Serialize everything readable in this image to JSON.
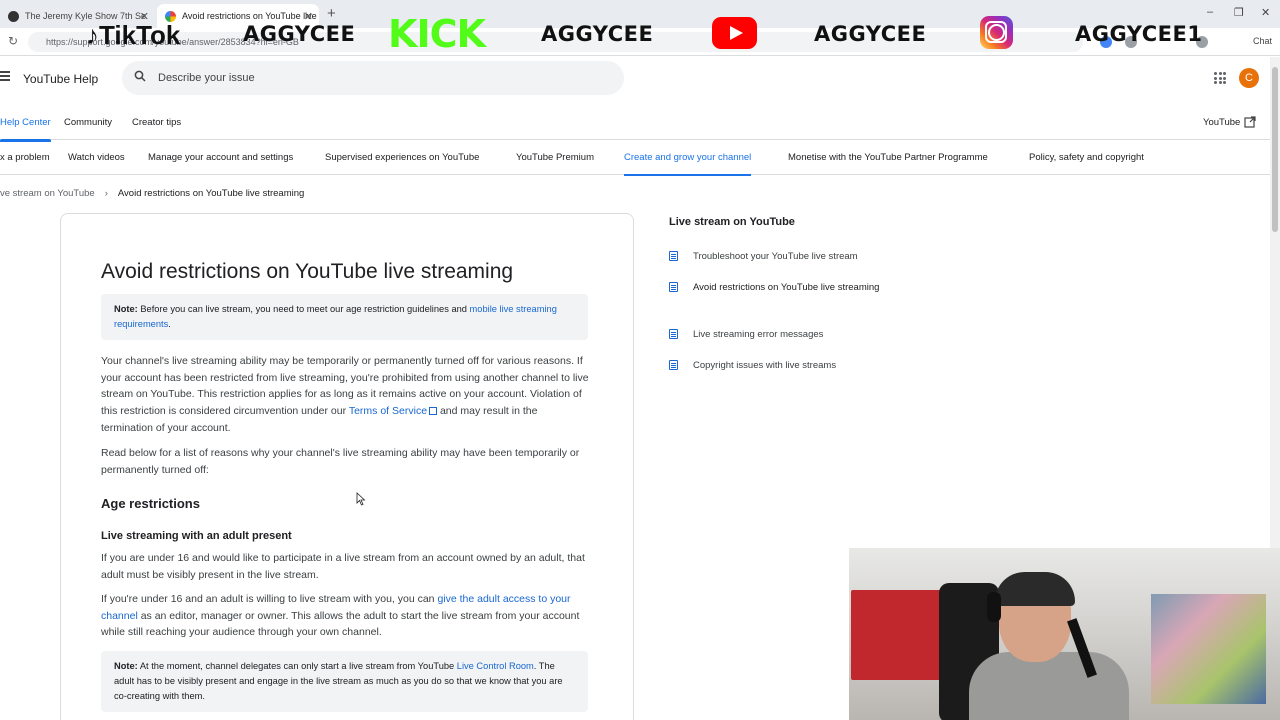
{
  "browser": {
    "tabs": [
      {
        "title": "The Jeremy Kyle Show 7th Se",
        "close": "✕"
      },
      {
        "title": "Avoid restrictions on YouTube live",
        "close": "✕"
      }
    ],
    "new_tab": "+",
    "url": "https://support.google.com/youtube/answer/2853834?hl=en-GB",
    "chat_label": "Chat",
    "window_controls": [
      "–",
      "❐",
      "✕"
    ]
  },
  "overlay": {
    "tiktok_label": "TikTok",
    "tiktok_name": "AGGYCEE",
    "kick_label": "KICK",
    "kick_name": "AGGYCEE",
    "youtube_name": "AGGYCEE",
    "instagram_name": "AGGYCEE1",
    "colors": {
      "kick": "#53fc18",
      "youtube": "#ff0000"
    }
  },
  "header": {
    "brand": "YouTube Help",
    "search_placeholder": "Describe your issue",
    "avatar_initial": "C",
    "avatar_color": "#e8710a"
  },
  "subnav": {
    "items": [
      "Help Center",
      "Community",
      "Creator tips"
    ],
    "active_index": 0,
    "youtube_link": "YouTube"
  },
  "topics": {
    "items": [
      "x a problem",
      "Watch videos",
      "Manage your account and settings",
      "Supervised experiences on YouTube",
      "YouTube Premium",
      "Create and grow your channel",
      "Monetise with the YouTube Partner Programme",
      "Policy, safety and copyright"
    ],
    "active_index": 5,
    "accent": "#1a73e8"
  },
  "breadcrumb": {
    "parent": "ve stream on YouTube",
    "separator": "›",
    "current": "Avoid restrictions on YouTube live streaming"
  },
  "article": {
    "title": "Avoid restrictions on YouTube live streaming",
    "note1": {
      "label": "Note:",
      "text": " Before you can live stream, you need to meet our age restriction guidelines and ",
      "link": "mobile live streaming requirements",
      "end": "."
    },
    "para1": {
      "text": "Your channel's live streaming ability may be temporarily or permanently turned off for various reasons. If your account has been restricted from live streaming, you're prohibited from using another channel to live stream on YouTube. This restriction applies for as long as it remains active on your account. Violation of this restriction is considered circumvention under our ",
      "link": "Terms of Service",
      "end": " and may result in the termination of your account."
    },
    "para2": "Read below for a list of reasons why your channel's live streaming ability may have been temporarily or permanently turned off:",
    "section_heading": "Age restrictions",
    "subheading": "Live streaming with an adult present",
    "para3": "If you are under 16 and would like to participate in a live stream from an account owned by an adult, that adult must be visibly present in the live stream.",
    "para4": {
      "text": "If you're under 16 and an adult is willing to live stream with you, you can ",
      "link": "give the adult access to your channel",
      "end": " as an editor, manager or owner. This allows the adult to start the live stream from your account while still reaching your audience through your own channel."
    },
    "note2": {
      "label": "Note:",
      "text": " At the moment, channel delegates can only start a live stream from YouTube ",
      "link": "Live Control Room",
      "end": ". The adult has to be visibly present and engage in the live stream as much as you do so that we know that you are co-creating with them."
    }
  },
  "sidebar": {
    "title": "Live stream on YouTube",
    "items": [
      {
        "label": "Troubleshoot your YouTube live stream",
        "icon": "article-icon"
      },
      {
        "label": "Avoid restrictions on YouTube live streaming",
        "icon": "article-icon"
      },
      {
        "label": "Live streaming error messages",
        "icon": "article-icon"
      },
      {
        "label": "Copyright issues with live streams",
        "icon": "article-icon"
      }
    ],
    "current_index": 1
  }
}
